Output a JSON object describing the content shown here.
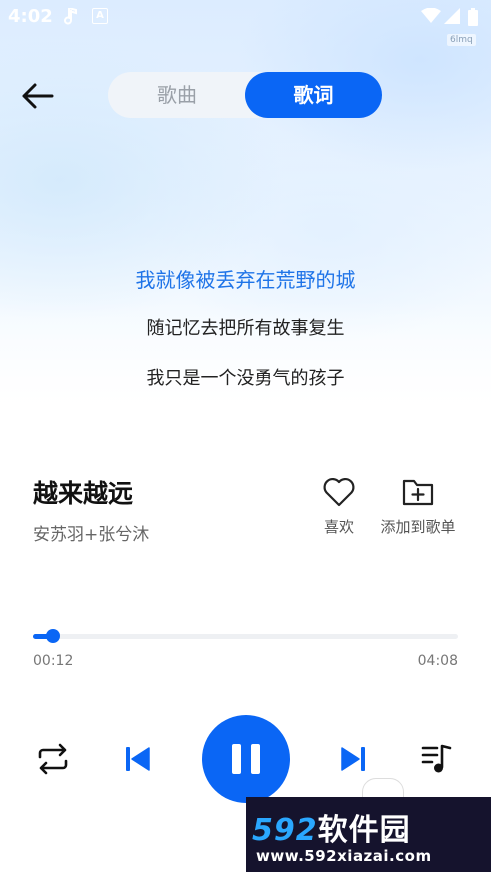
{
  "status_bar": {
    "time": "4:02",
    "tag": "6lmq"
  },
  "header": {
    "tabs": [
      {
        "label": "歌曲",
        "active": false
      },
      {
        "label": "歌词",
        "active": true
      }
    ]
  },
  "lyrics": [
    {
      "text": "我就像被丢弃在荒野的城",
      "current": true
    },
    {
      "text": "随记忆去把所有故事复生",
      "current": false
    },
    {
      "text": "我只是一个没勇气的孩子",
      "current": false
    }
  ],
  "song": {
    "title": "越来越远",
    "artist": "安苏羽+张兮沐"
  },
  "actions": {
    "like_label": "喜欢",
    "add_label": "添加到歌单"
  },
  "progress": {
    "current": "00:12",
    "total": "04:08",
    "fraction": 0.048
  },
  "controls": {
    "repeat_icon": "repeat-icon",
    "prev_icon": "skip-previous-icon",
    "play_state": "playing",
    "next_icon": "skip-next-icon",
    "playlist_icon": "playlist-icon"
  },
  "watermark": {
    "logo_num": "592",
    "logo_text": "软件园",
    "url": "www.592xiazai.com"
  },
  "colors": {
    "accent": "#0a66f5",
    "current_lyric": "#1f74e8"
  }
}
